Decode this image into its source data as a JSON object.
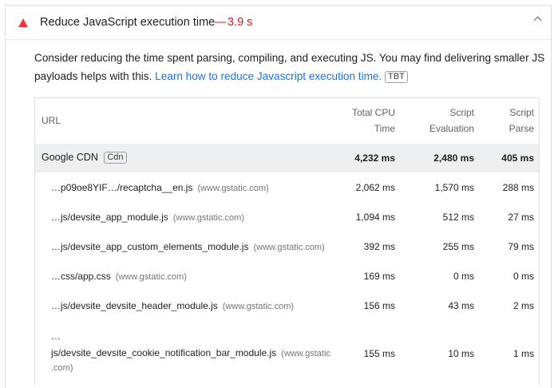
{
  "audit": {
    "title": "Reduce JavaScript execution time",
    "dash": "—",
    "metric": "3.9 s",
    "status_icon": "warning-triangle-icon",
    "status_color": "#ff3333",
    "description": "Consider reducing the time spent parsing, compiling, and executing JS. You may find delivering smaller JS payloads helps with this.",
    "link_text": "Learn how to reduce Javascript execution time.",
    "badge": "TBT"
  },
  "table": {
    "headers": {
      "url": "URL",
      "total_cpu": [
        "Total CPU",
        "Time"
      ],
      "script_eval": [
        "Script",
        "Evaluation"
      ],
      "script_parse": [
        "Script",
        "Parse"
      ]
    },
    "group": {
      "name": "Google CDN",
      "badge": "Cdn",
      "total": "4,232 ms",
      "eval": "2,480 ms",
      "parse": "405 ms"
    },
    "rows": [
      {
        "url": "…p09oe8YIF…/recaptcha__en.js",
        "host": "(www.gstatic.com)",
        "total": "2,062 ms",
        "eval": "1,570 ms",
        "parse": "288 ms"
      },
      {
        "url": "…js/devsite_app_module.js",
        "host": "(www.gstatic.com)",
        "total": "1,094 ms",
        "eval": "512 ms",
        "parse": "27 ms"
      },
      {
        "url": "…js/devsite_app_custom_elements_module.js",
        "host": "(www.gstatic.com)",
        "total": "392 ms",
        "eval": "255 ms",
        "parse": "79 ms"
      },
      {
        "url": "…css/app.css",
        "host": "(www.gstatic.com)",
        "total": "169 ms",
        "eval": "0 ms",
        "parse": "0 ms"
      },
      {
        "url": "…js/devsite_devsite_header_module.js",
        "host": "(www.gstatic.com)",
        "total": "156 ms",
        "eval": "43 ms",
        "parse": "2 ms"
      },
      {
        "url_line1": "…",
        "url_line2": "js/devsite_devsite_cookie_notification_bar_module.js",
        "host_line1": "(www.gstatic",
        "host_line2": ".com)",
        "total": "155 ms",
        "eval": "10 ms",
        "parse": "1 ms"
      }
    ]
  }
}
